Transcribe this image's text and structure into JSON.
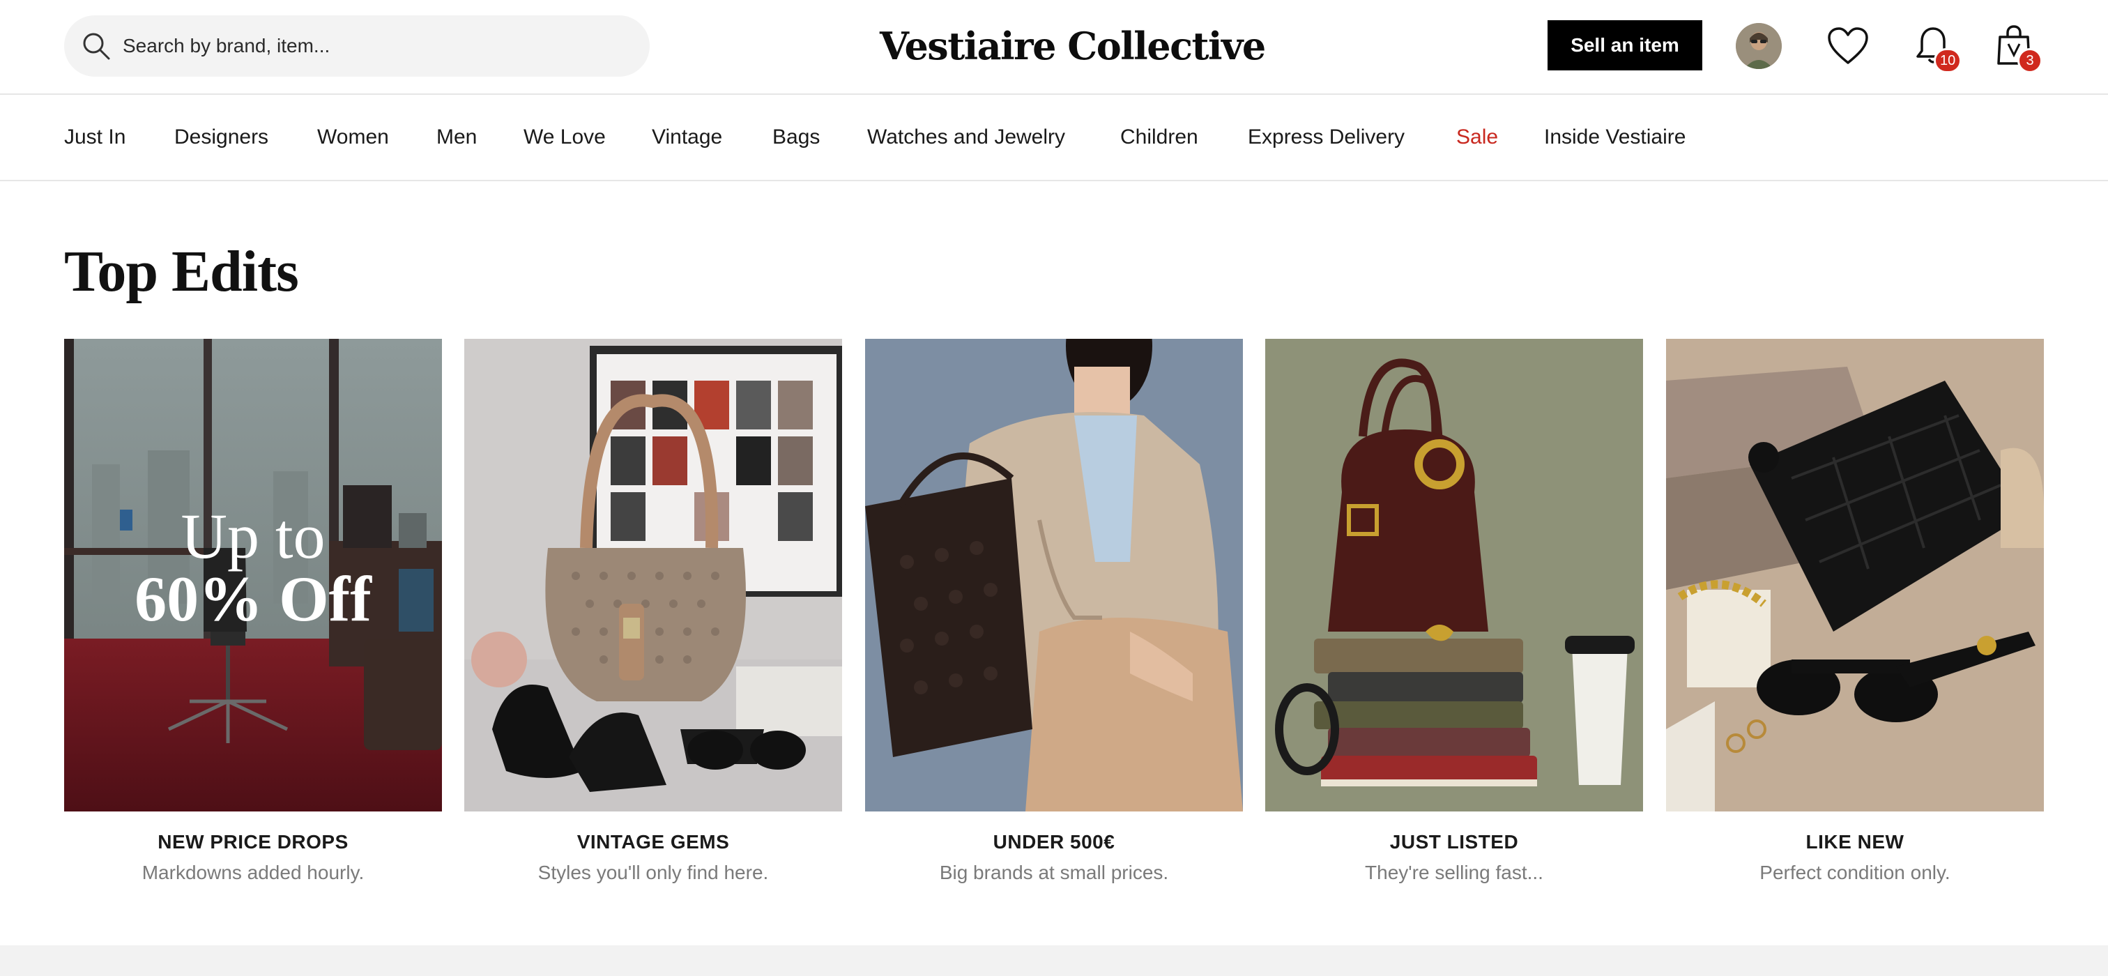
{
  "header": {
    "search_placeholder": "Search by brand, item...",
    "logo": "Vestiaire Collective",
    "sell_label": "Sell an item",
    "notifications_count": "10",
    "cart_count": "3"
  },
  "nav": {
    "items": [
      "Just In",
      "Designers",
      "Women",
      "Men",
      "We Love",
      "Vintage",
      "Bags",
      "Watches and Jewelry",
      "Children",
      "Express Delivery",
      "Sale",
      "Inside Vestiaire"
    ]
  },
  "section": {
    "title": "Top Edits"
  },
  "cards": [
    {
      "title": "NEW PRICE DROPS",
      "subtitle": "Markdowns added hourly.",
      "overlay_line1": "Up to",
      "overlay_line2": "60% Off"
    },
    {
      "title": "VINTAGE GEMS",
      "subtitle": "Styles you'll only find here."
    },
    {
      "title": "UNDER 500€",
      "subtitle": "Big brands at small prices."
    },
    {
      "title": "JUST LISTED",
      "subtitle": "They're selling fast..."
    },
    {
      "title": "LIKE NEW",
      "subtitle": "Perfect condition only."
    }
  ],
  "icons": {
    "search": "search-icon",
    "wishlist": "heart-icon",
    "notifications": "bell-icon",
    "cart": "shopping-bag-icon"
  },
  "colors": {
    "sale": "#c8281f",
    "badge": "#d0291e",
    "button": "#000000"
  }
}
